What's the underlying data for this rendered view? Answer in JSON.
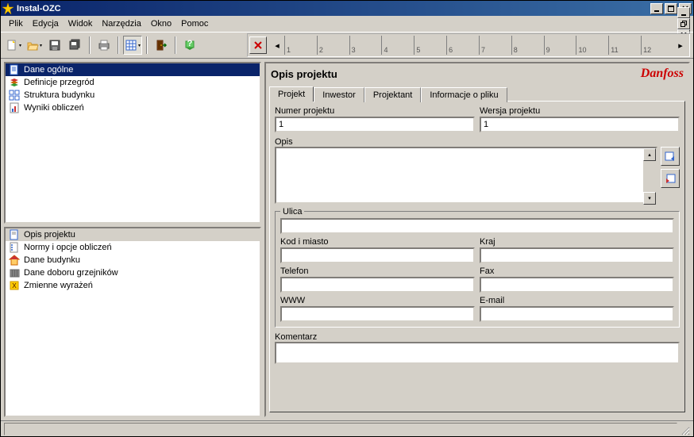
{
  "window": {
    "title": "Instal-OZC"
  },
  "menu": [
    "Plik",
    "Edycja",
    "Widok",
    "Narzędzia",
    "Okno",
    "Pomoc"
  ],
  "tabstrip": {
    "labels": [
      "1",
      "2",
      "3",
      "4",
      "5",
      "6",
      "7",
      "8",
      "9",
      "10",
      "11",
      "12"
    ]
  },
  "tree_top": [
    {
      "label": "Dane ogólne",
      "selected": true
    },
    {
      "label": "Definicje przegród"
    },
    {
      "label": "Struktura budynku"
    },
    {
      "label": "Wyniki obliczeń"
    }
  ],
  "tree_bottom": [
    {
      "label": "Opis projektu",
      "selected": true
    },
    {
      "label": "Normy i opcje obliczeń"
    },
    {
      "label": "Dane budynku"
    },
    {
      "label": "Dane doboru grzejników"
    },
    {
      "label": "Zmienne wyrażeń"
    }
  ],
  "right": {
    "title": "Opis projektu",
    "logo": "Danfoss",
    "tabs": [
      "Projekt",
      "Inwestor",
      "Projektant",
      "Informacje o pliku"
    ],
    "fields": {
      "numer_label": "Numer projektu",
      "numer_value": "1",
      "wersja_label": "Wersja projektu",
      "wersja_value": "1",
      "opis_label": "Opis",
      "opis_value": "",
      "ulica_label": "Ulica",
      "ulica_value": "",
      "kod_label": "Kod i miasto",
      "kod_value": "",
      "kraj_label": "Kraj",
      "kraj_value": "",
      "telefon_label": "Telefon",
      "telefon_value": "",
      "fax_label": "Fax",
      "fax_value": "",
      "www_label": "WWW",
      "www_value": "",
      "email_label": "E-mail",
      "email_value": "",
      "komentarz_label": "Komentarz",
      "komentarz_value": ""
    }
  }
}
